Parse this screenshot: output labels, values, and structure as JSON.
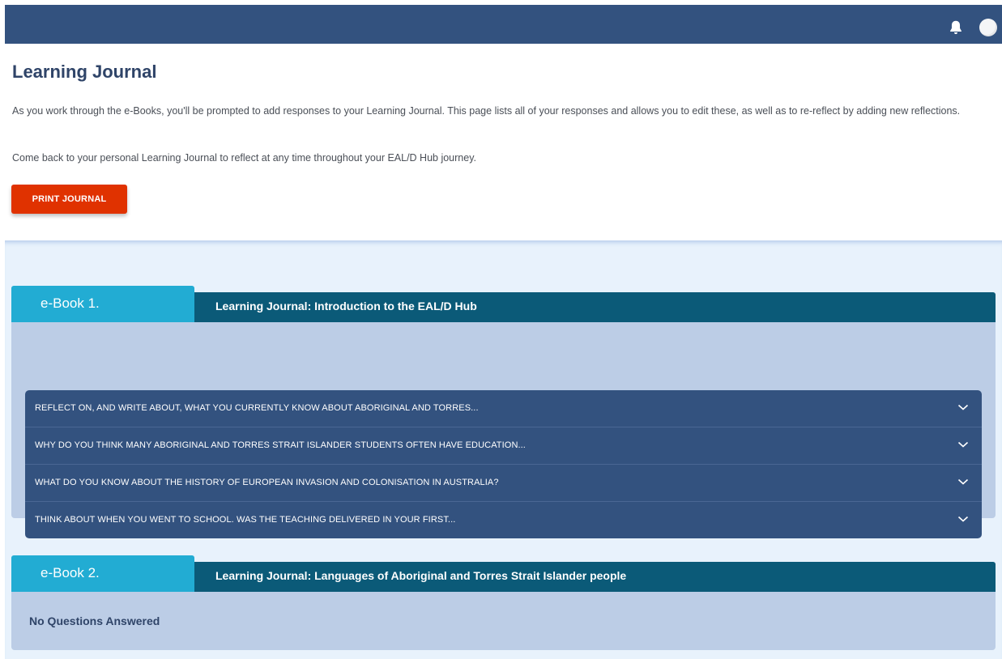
{
  "topbar": {
    "icons": {
      "notifications": "bell-icon",
      "user": "avatar"
    },
    "color": "#33527f"
  },
  "page": {
    "title": "Learning Journal",
    "intro": "As you work through the e-Books, you'll be prompted to add responses to your Learning Journal. This page lists all of your responses and allows you to edit these, as well as to re-reflect by adding new reflections.",
    "reminder": "Come back to your personal Learning Journal to reflect at any time throughout your EAL/D Hub journey.",
    "print_label": "PRINT JOURNAL"
  },
  "ebooks": [
    {
      "label": "e-Book 1.",
      "title": "Learning Journal: Introduction to the EAL/D Hub",
      "questions": [
        "REFLECT ON, AND WRITE ABOUT, WHAT YOU CURRENTLY KNOW ABOUT ABORIGINAL AND TORRES...",
        "WHY DO YOU THINK MANY ABORIGINAL AND TORRES STRAIT ISLANDER STUDENTS OFTEN HAVE EDUCATION...",
        "WHAT DO YOU KNOW ABOUT THE HISTORY OF EUROPEAN INVASION AND COLONISATION IN AUSTRALIA?",
        "THINK ABOUT WHEN YOU WENT TO SCHOOL. WAS THE TEACHING DELIVERED IN YOUR FIRST..."
      ]
    },
    {
      "label": "e-Book 2.",
      "title": "Learning Journal: Languages of Aboriginal and Torres Strait Islander people",
      "empty_text": "No Questions Answered"
    }
  ],
  "colors": {
    "accent_button": "#e03200",
    "tab": "#22acd3",
    "band": "#0b5a78",
    "panel": "#bccde6",
    "question_list": "#33527f"
  }
}
